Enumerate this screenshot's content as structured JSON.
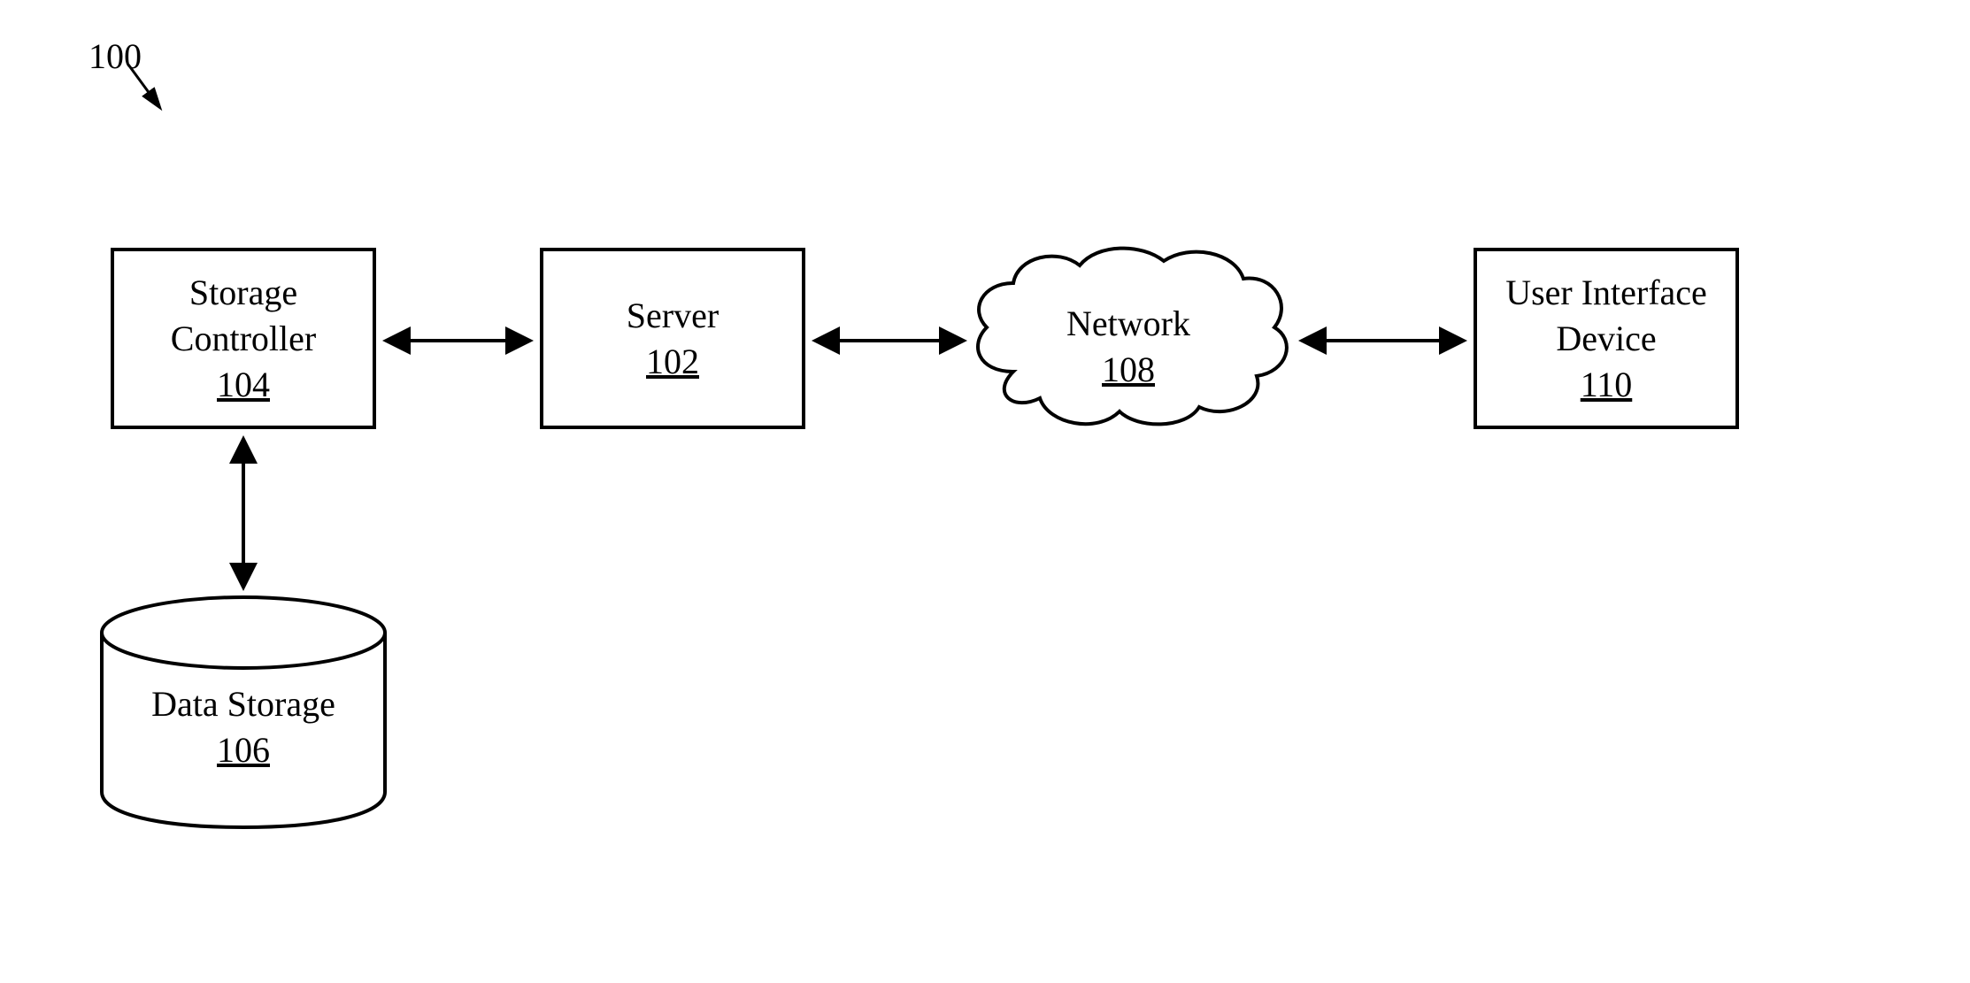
{
  "figure": {
    "number_label": "100"
  },
  "nodes": {
    "storage_controller": {
      "label": "Storage Controller",
      "ref": "104"
    },
    "server": {
      "label": "Server",
      "ref": "102"
    },
    "network": {
      "label": "Network",
      "ref": "108"
    },
    "user_interface_device": {
      "label_line1": "User Interface",
      "label_line2": "Device",
      "ref": "110"
    },
    "data_storage": {
      "label": "Data Storage",
      "ref": "106"
    }
  }
}
